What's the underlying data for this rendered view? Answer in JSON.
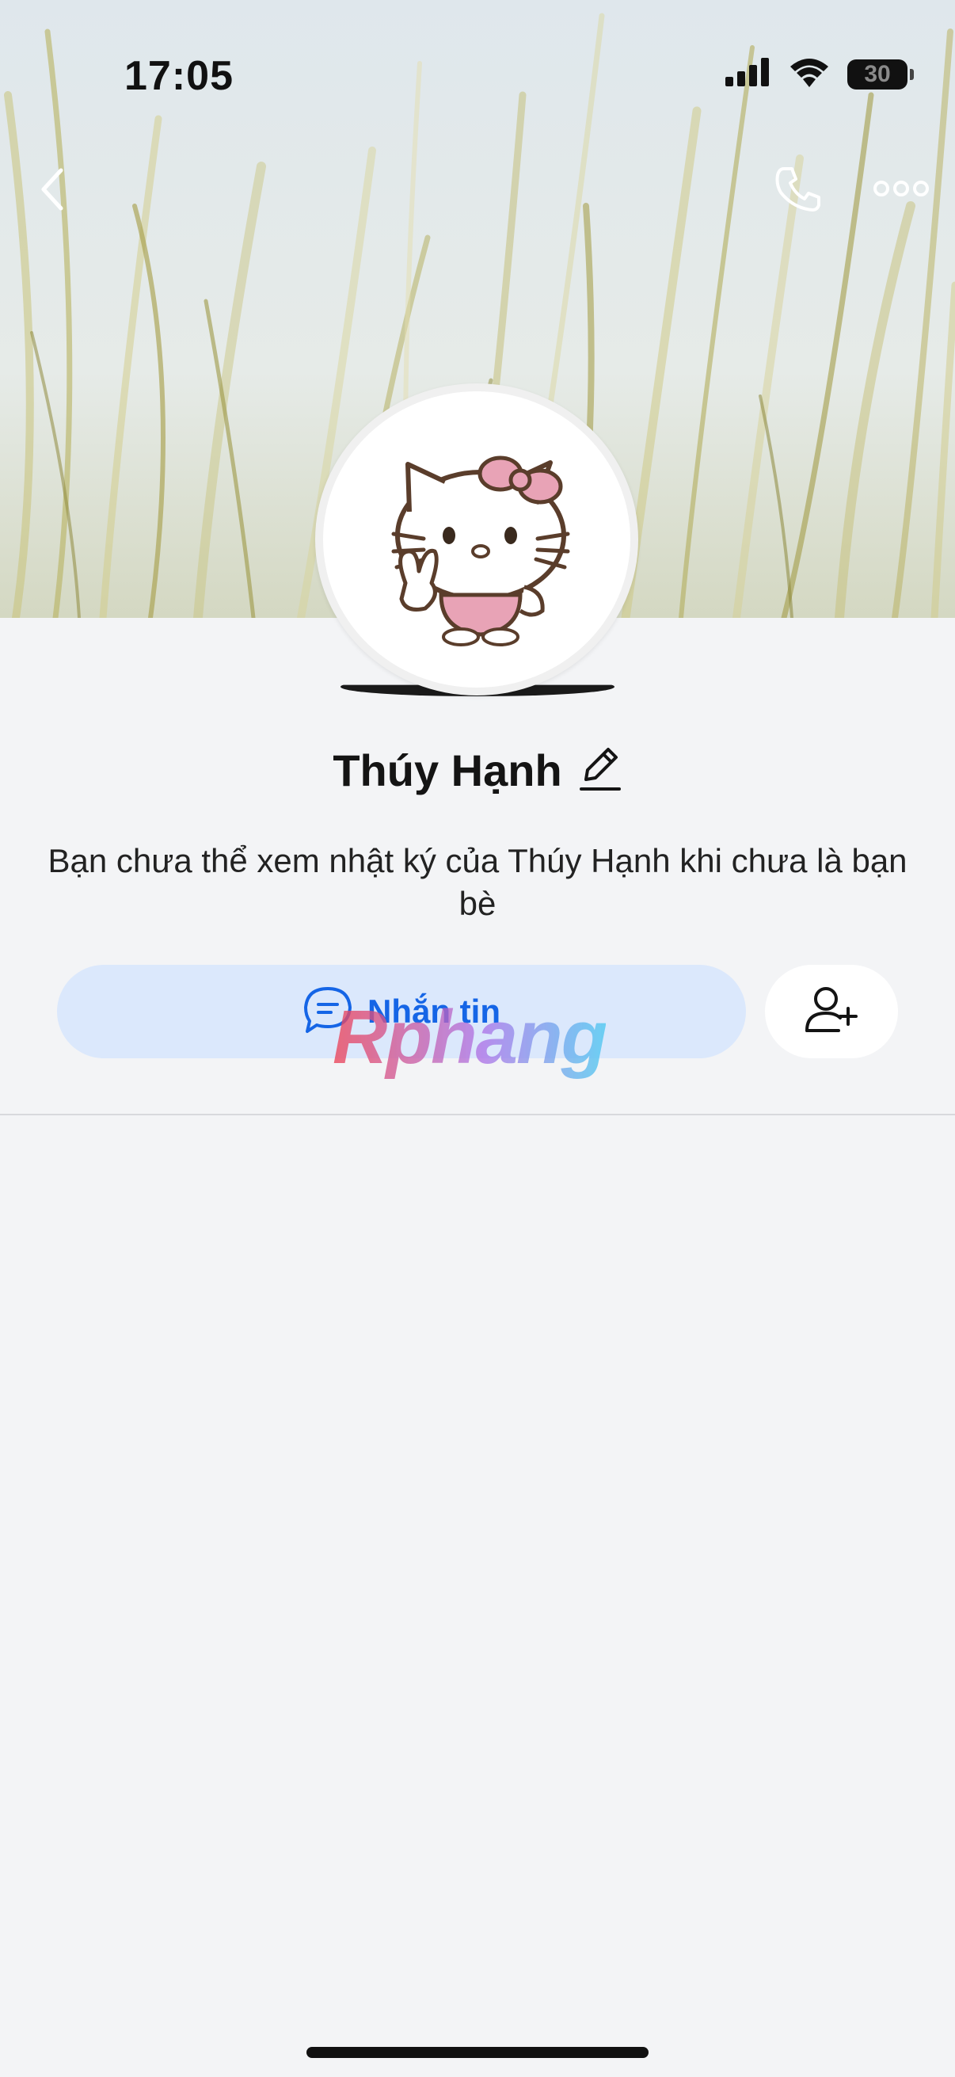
{
  "status_bar": {
    "time": "17:05",
    "battery_level": "30",
    "icons": [
      "cellular-signal-icon",
      "wifi-icon",
      "battery-icon"
    ]
  },
  "nav": {
    "icons": [
      "back-chevron-icon",
      "phone-call-icon",
      "more-options-icon"
    ]
  },
  "profile": {
    "name": "Thúy Hạnh",
    "description": "Bạn chưa thể xem nhật ký của Thúy Hạnh khi chưa là bạn bè"
  },
  "actions": {
    "message_label": "Nhắn tin",
    "icons": [
      "chat-bubble-icon",
      "add-friend-icon"
    ]
  },
  "watermark": {
    "text": "Rphang"
  },
  "colors": {
    "accent": "#1565e6",
    "message_button_bg": "#dbe8fc",
    "background": "#f3f4f6"
  }
}
